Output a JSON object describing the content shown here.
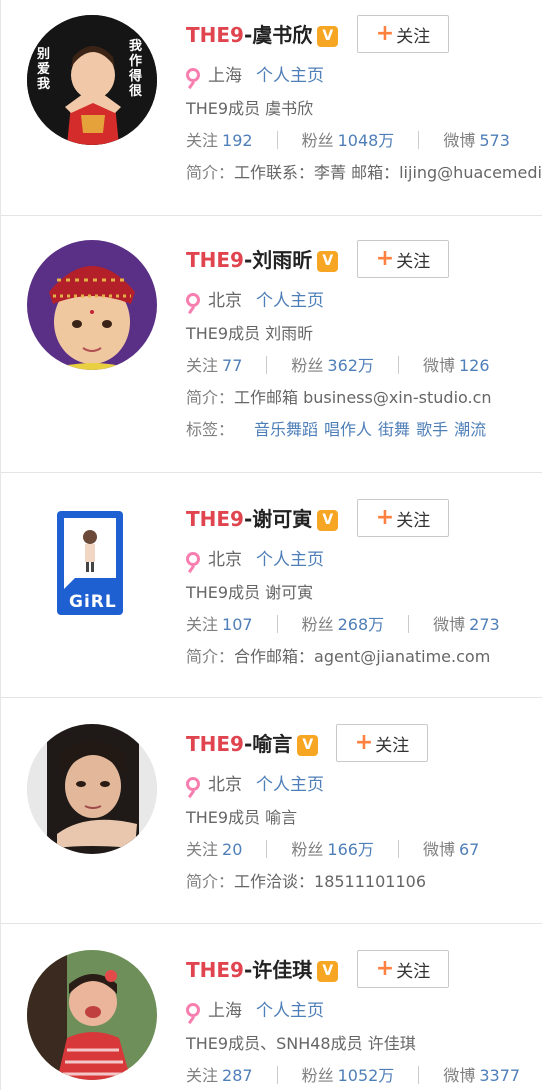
{
  "users": [
    {
      "prefix": "THE9",
      "name": "-虞书欣",
      "verified": "V",
      "follow_label": "关注",
      "location": "上海",
      "home_link": "个人主页",
      "desc": "THE9成员 虞书欣",
      "stats": {
        "follow_label": "关注",
        "follow": "192",
        "fans_label": "粉丝",
        "fans": "1048万",
        "weibo_label": "微博",
        "weibo": "573"
      },
      "intro_label": "简介：",
      "intro": "工作联系：李菁 邮箱：lijing@huacemedia.com",
      "avatar_text": {
        "left": "别爱我",
        "right": "我作得很"
      }
    },
    {
      "prefix": "THE9",
      "name": "-刘雨昕",
      "verified": "V",
      "follow_label": "关注",
      "location": "北京",
      "home_link": "个人主页",
      "desc": "THE9成员 刘雨昕",
      "stats": {
        "follow_label": "关注",
        "follow": "77",
        "fans_label": "粉丝",
        "fans": "362万",
        "weibo_label": "微博",
        "weibo": "126"
      },
      "intro_label": "简介：",
      "intro": "工作邮箱 business@xin-studio.cn",
      "tags_label": "标签：",
      "tags": [
        "音乐舞蹈",
        "唱作人",
        "街舞",
        "歌手",
        "潮流"
      ]
    },
    {
      "prefix": "THE9",
      "name": "-谢可寅",
      "verified": "V",
      "follow_label": "关注",
      "location": "北京",
      "home_link": "个人主页",
      "desc": "THE9成员 谢可寅",
      "stats": {
        "follow_label": "关注",
        "follow": "107",
        "fans_label": "粉丝",
        "fans": "268万",
        "weibo_label": "微博",
        "weibo": "273"
      },
      "intro_label": "简介：",
      "intro": "合作邮箱：agent@jianatime.com",
      "avatar_text": {
        "logo": "GiRL"
      }
    },
    {
      "prefix": "THE9",
      "name": "-喻言",
      "verified": "V",
      "follow_label": "关注",
      "location": "北京",
      "home_link": "个人主页",
      "desc": "THE9成员 喻言",
      "stats": {
        "follow_label": "关注",
        "follow": "20",
        "fans_label": "粉丝",
        "fans": "166万",
        "weibo_label": "微博",
        "weibo": "67"
      },
      "intro_label": "简介：",
      "intro": "工作洽谈：18511101106"
    },
    {
      "prefix": "THE9",
      "name": "-许佳琪",
      "verified": "V",
      "follow_label": "关注",
      "location": "上海",
      "home_link": "个人主页",
      "desc": "THE9成员、SNH48成员 许佳琪",
      "stats": {
        "follow_label": "关注",
        "follow": "287",
        "fans_label": "粉丝",
        "fans": "1052万",
        "weibo_label": "微博",
        "weibo": "3377"
      }
    }
  ],
  "colors": {
    "prefix": "#e0454f",
    "link": "#4f7fb8",
    "verified": "#f6a623",
    "female": "#f77fb0",
    "plus": "#ff8140"
  }
}
